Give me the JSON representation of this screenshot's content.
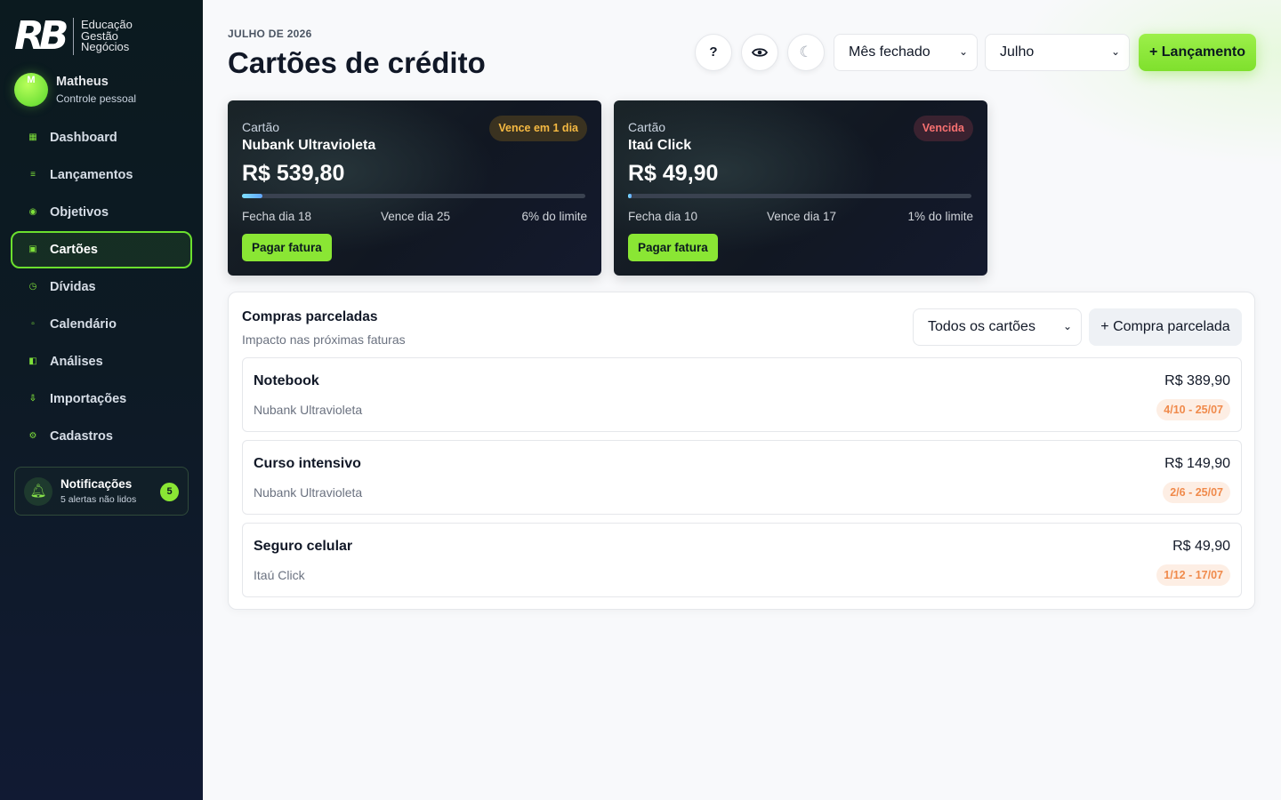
{
  "brand": {
    "logo_text": "RB",
    "line1": "Educação",
    "line2": "Gestão",
    "line3": "Negócios"
  },
  "user": {
    "initial": "M",
    "name": "Matheus",
    "role": "Controle pessoal"
  },
  "sidebar": {
    "items": [
      {
        "label": "Dashboard",
        "icon": "grid-icon"
      },
      {
        "label": "Lançamentos",
        "icon": "list-icon"
      },
      {
        "label": "Objetivos",
        "icon": "target-icon"
      },
      {
        "label": "Cartões",
        "icon": "card-icon",
        "active": true
      },
      {
        "label": "Dívidas",
        "icon": "clock-icon"
      },
      {
        "label": "Calendário",
        "icon": "calendar-icon"
      },
      {
        "label": "Análises",
        "icon": "chart-icon"
      },
      {
        "label": "Importações",
        "icon": "download-icon"
      },
      {
        "label": "Cadastros",
        "icon": "gear-icon"
      }
    ]
  },
  "notifications": {
    "title": "Notificações",
    "subtitle": "5 alertas não lidos",
    "count": "5"
  },
  "header": {
    "eyebrow": "JULHO DE 2026",
    "title": "Cartões de crédito",
    "help_label": "?",
    "period_select": "Mês fechado",
    "month_select": "Julho",
    "new_entry_label": "+ Lançamento"
  },
  "cards": [
    {
      "label": "Cartão",
      "name": "Nubank Ultravioleta",
      "amount": "R$ 539,80",
      "badge": "Vence em 1 dia",
      "badge_type": "warning",
      "closing": "Fecha dia 18",
      "due": "Vence dia 25",
      "limit_text": "6% do limite",
      "limit_fraction": 0.06,
      "pay_label": "Pagar fatura"
    },
    {
      "label": "Cartão",
      "name": "Itaú Click",
      "amount": "R$ 49,90",
      "badge": "Vencida",
      "badge_type": "danger",
      "closing": "Fecha dia 10",
      "due": "Vence dia 17",
      "limit_text": "1% do limite",
      "limit_fraction": 0.01,
      "pay_label": "Pagar fatura"
    }
  ],
  "installments": {
    "title": "Compras parceladas",
    "subtitle": "Impacto nas próximas faturas",
    "filter_select": "Todos os cartões",
    "add_label": "+ Compra parcelada",
    "rows": [
      {
        "name": "Notebook",
        "card": "Nubank Ultravioleta",
        "value": "R$ 389,90",
        "badge": "4/10 - 25/07"
      },
      {
        "name": "Curso intensivo",
        "card": "Nubank Ultravioleta",
        "value": "R$ 149,90",
        "badge": "2/6 - 25/07"
      },
      {
        "name": "Seguro celular",
        "card": "Itaú Click",
        "value": "R$ 49,90",
        "badge": "1/12 - 17/07"
      }
    ]
  },
  "colors": {
    "accent": "#8ae634",
    "sidebar_bg": "#0d1a24",
    "warning": "#f5b942",
    "danger": "#f87171",
    "installment_badge": "#f08a4b"
  }
}
